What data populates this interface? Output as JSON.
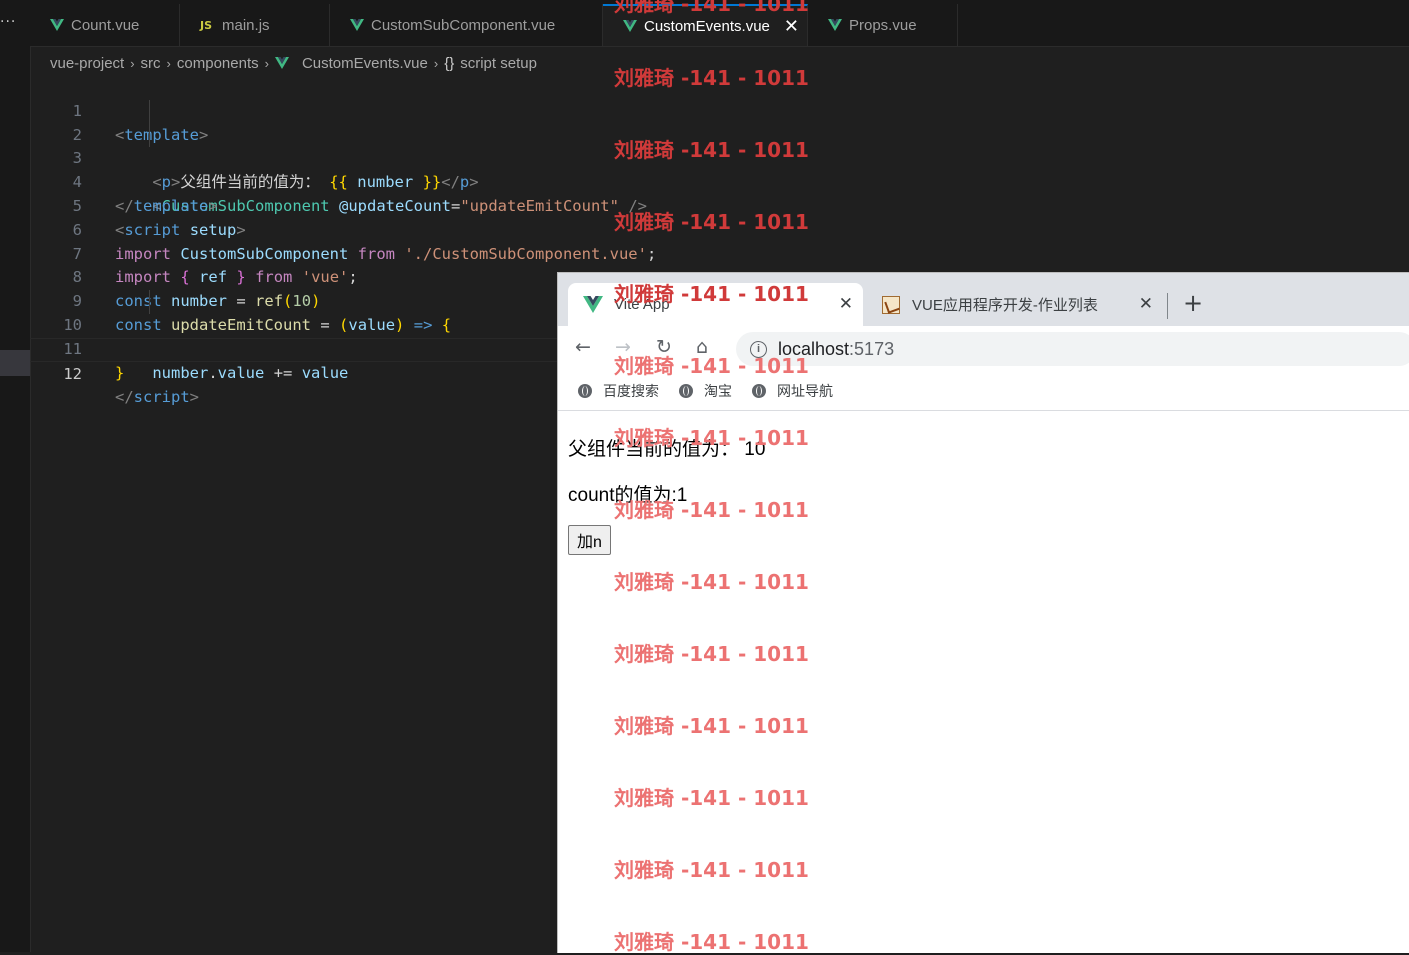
{
  "activity_bar": {
    "more_label": "..."
  },
  "editor_tabs": [
    {
      "label": "Count.vue",
      "icon": "vue-icon"
    },
    {
      "label": "main.js",
      "icon": "js-icon",
      "icon_text": "JS"
    },
    {
      "label": "CustomSubComponent.vue",
      "icon": "vue-icon"
    },
    {
      "label": "CustomEvents.vue",
      "icon": "vue-icon",
      "active": true,
      "close": "✕"
    },
    {
      "label": "Props.vue",
      "icon": "vue-icon"
    }
  ],
  "breadcrumb": {
    "items": [
      "vue-project",
      "src",
      "components",
      "CustomEvents.vue",
      "script setup"
    ],
    "symbol_icon": "{}"
  },
  "code_lines": [
    {
      "n": "1"
    },
    {
      "n": "2"
    },
    {
      "n": "3"
    },
    {
      "n": "4"
    },
    {
      "n": "5"
    },
    {
      "n": "6"
    },
    {
      "n": "7"
    },
    {
      "n": "8"
    },
    {
      "n": "9"
    },
    {
      "n": "10"
    },
    {
      "n": "11"
    },
    {
      "n": "12"
    }
  ],
  "code": {
    "l1_tag": "template",
    "l2_tag": "p",
    "l2_text": "父组件当前的值为：",
    "l2_var": "number",
    "l3_comp": "CustomSubComponent",
    "l3_attr": "@updateCount",
    "l3_val": "\"updateEmitCount\"",
    "l4_tag": "template",
    "l5_tag": "script",
    "l5_attr": "setup",
    "l6_kw": "import",
    "l6_name": "CustomSubComponent",
    "l6_from": "from",
    "l6_str": "'./CustomSubComponent.vue'",
    "l7_kw": "import",
    "l7_name": "ref",
    "l7_from": "from",
    "l7_str": "'vue'",
    "l8_kw": "const",
    "l8_name": "number",
    "l8_fn": "ref",
    "l8_num": "10",
    "l9_kw": "const",
    "l9_name": "updateEmitCount",
    "l9_param": "value",
    "l10_obj": "number",
    "l10_prop": "value",
    "l10_op": "+=",
    "l10_val": "value",
    "l12_tag": "script"
  },
  "browser": {
    "tabs": [
      {
        "title": "Vite App",
        "favicon": "vite-icon",
        "close": "✕"
      },
      {
        "title": "VUE应用程序开发-作业列表",
        "favicon": "doc-icon",
        "close": "✕"
      }
    ],
    "new_tab": "+",
    "nav": {
      "back": "←",
      "forward": "→",
      "reload": "↻",
      "home": "⌂"
    },
    "url_host": "localhost",
    "url_port": ":5173",
    "bookmarks": [
      "百度搜索",
      "淘宝",
      "网址导航"
    ],
    "page": {
      "parent_label": "父组件当前的值为：",
      "parent_value": "10",
      "count_text": "count的值为:1",
      "button_label": "加n"
    }
  },
  "watermark": {
    "text": "刘雅琦 -141 - 1011"
  },
  "colors": {
    "editor_bg": "#1f1f1f",
    "active_tab_accent": "#0078d4",
    "vue_green": "#41b883",
    "watermark_red": "#d03a3a"
  }
}
